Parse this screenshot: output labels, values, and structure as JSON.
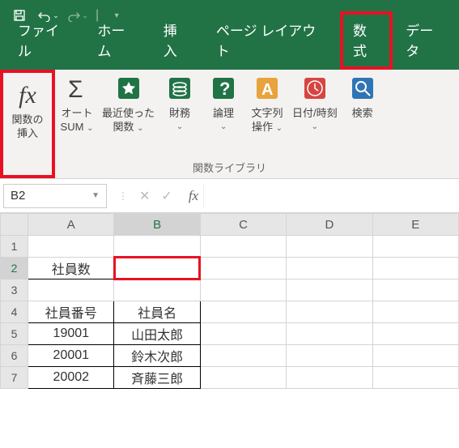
{
  "titlebar": {
    "save_icon": "save",
    "undo_icon": "undo",
    "redo_icon": "redo"
  },
  "tabs": {
    "file": "ファイル",
    "home": "ホーム",
    "insert": "挿入",
    "pagelayout": "ページ レイアウト",
    "formulas": "数式",
    "data": "データ"
  },
  "ribbon": {
    "insert_fn_icon": "fx",
    "insert_fn_l1": "関数の",
    "insert_fn_l2": "挿入",
    "autosum_l1": "オート",
    "autosum_l2": "SUM",
    "recent_l1": "最近使った",
    "recent_l2": "関数",
    "financial": "財務",
    "logical": "論理",
    "text_l1": "文字列",
    "text_l2": "操作",
    "datetime": "日付/時刻",
    "lookup": "検索",
    "group_label": "関数ライブラリ",
    "dropdown": "⌄"
  },
  "formula_bar": {
    "name_box": "B2",
    "fx": "fx"
  },
  "columns": [
    "A",
    "B",
    "C",
    "D",
    "E"
  ],
  "rows": {
    "r1": {
      "num": "1"
    },
    "r2": {
      "num": "2",
      "a": "社員数"
    },
    "r3": {
      "num": "3"
    },
    "r4": {
      "num": "4",
      "a": "社員番号",
      "b": "社員名"
    },
    "r5": {
      "num": "5",
      "a": "19001",
      "b": "山田太郎"
    },
    "r6": {
      "num": "6",
      "a": "20001",
      "b": "鈴木次郎"
    },
    "r7": {
      "num": "7",
      "a": "20002",
      "b": "斉藤三郎"
    }
  }
}
